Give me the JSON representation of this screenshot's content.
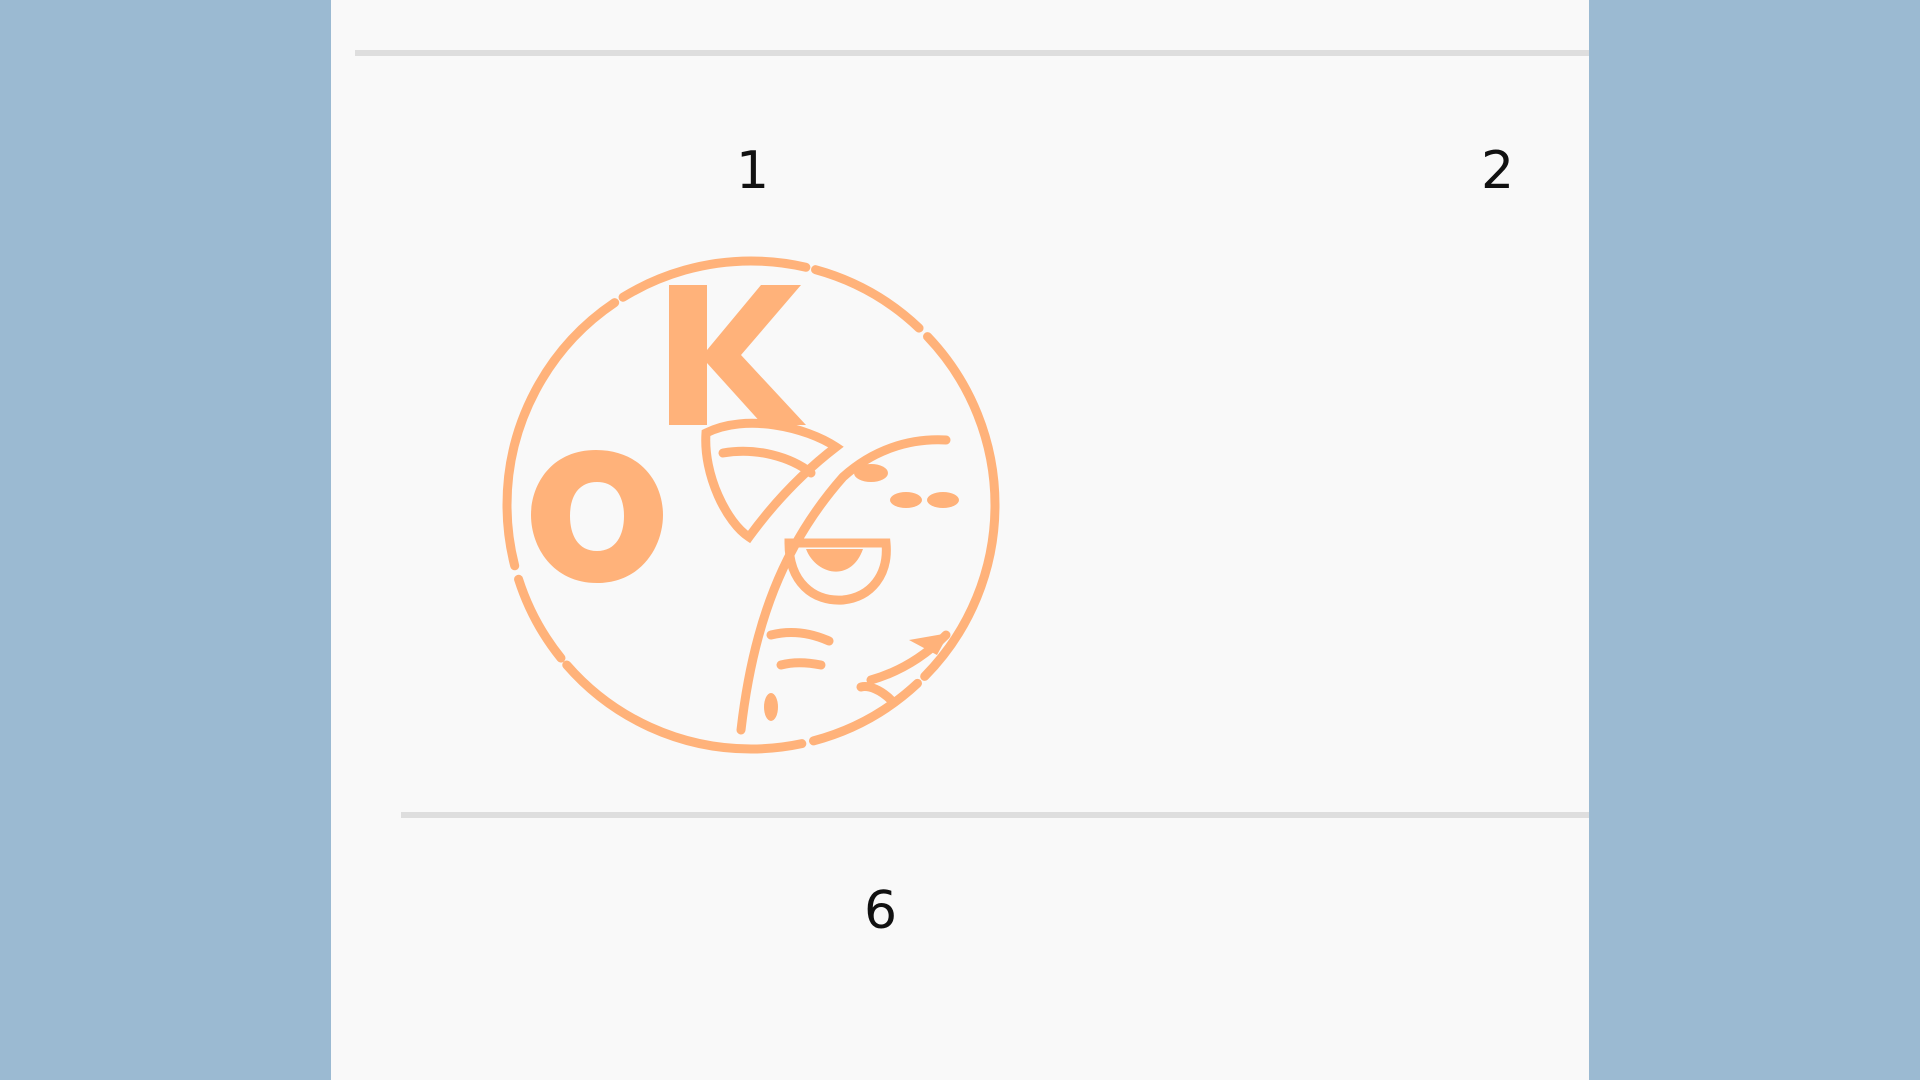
{
  "calendar": {
    "day_numbers": [
      "1",
      "2",
      "6"
    ]
  },
  "stamp": {
    "text": "OK",
    "color": "#ffb27a",
    "icon": "cat-ok-stamp-icon"
  },
  "colors": {
    "side_background": "#9bbad2",
    "page_background": "#f9f9f9",
    "divider": "#dedede"
  }
}
